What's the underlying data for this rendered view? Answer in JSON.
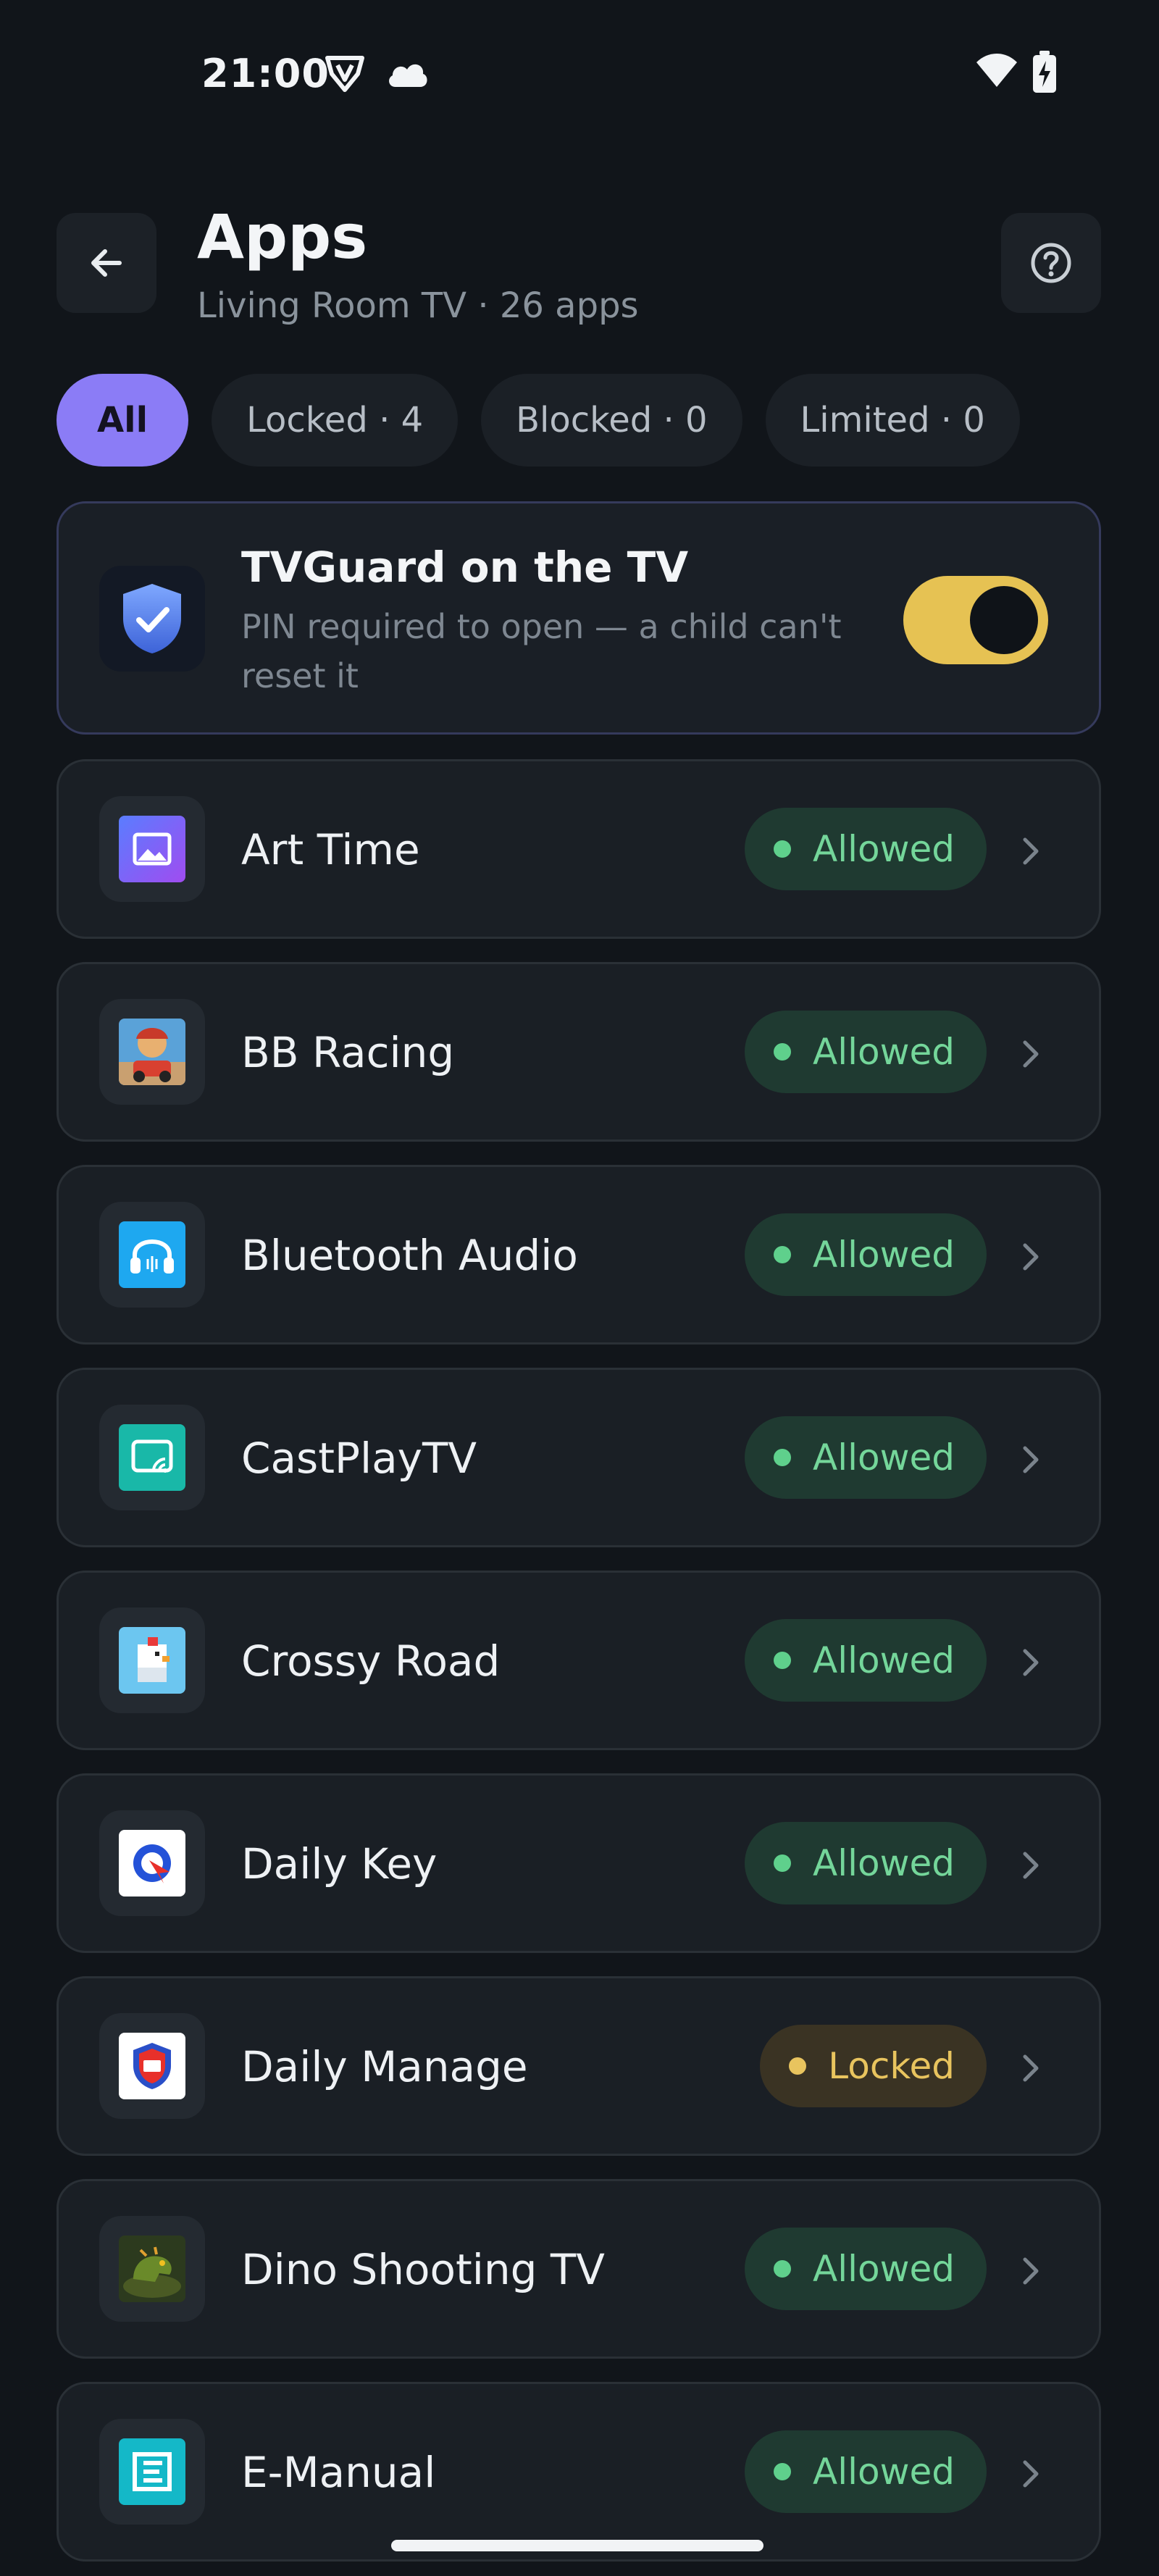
{
  "status_bar": {
    "time": "21:00",
    "icons": [
      "shield-v-icon",
      "cloud-icon",
      "wifi-icon",
      "battery-charging-icon"
    ]
  },
  "header": {
    "title": "Apps",
    "subtitle": "Living Room TV · 26 apps",
    "back_icon": "arrow-left-icon",
    "help_icon": "question-circle-icon"
  },
  "filters": [
    {
      "label": "All",
      "active": true
    },
    {
      "label": "Locked · 4",
      "active": false
    },
    {
      "label": "Blocked · 0",
      "active": false
    },
    {
      "label": "Limited · 0",
      "active": false
    }
  ],
  "guard": {
    "title": "TVGuard on the TV",
    "description": "PIN required to open — a child can't reset it",
    "enabled": true,
    "icon": "shield-check-icon"
  },
  "apps": [
    {
      "name": "Art Time",
      "status": "Allowed",
      "icon": "art-time-icon"
    },
    {
      "name": "BB Racing",
      "status": "Allowed",
      "icon": "bb-racing-icon"
    },
    {
      "name": "Bluetooth Audio",
      "status": "Allowed",
      "icon": "bluetooth-audio-icon"
    },
    {
      "name": "CastPlayTV",
      "status": "Allowed",
      "icon": "castplaytv-icon"
    },
    {
      "name": "Crossy Road",
      "status": "Allowed",
      "icon": "crossy-road-icon"
    },
    {
      "name": "Daily Key",
      "status": "Allowed",
      "icon": "daily-key-icon"
    },
    {
      "name": "Daily Manage",
      "status": "Locked",
      "icon": "daily-manage-icon"
    },
    {
      "name": "Dino Shooting TV",
      "status": "Allowed",
      "icon": "dino-shooting-icon"
    },
    {
      "name": "E-Manual",
      "status": "Allowed",
      "icon": "e-manual-icon"
    }
  ],
  "colors": {
    "accent": "#8b7cf6",
    "toggle_on": "#e6c253",
    "allowed": "#74d69a",
    "locked": "#e8c45e"
  }
}
